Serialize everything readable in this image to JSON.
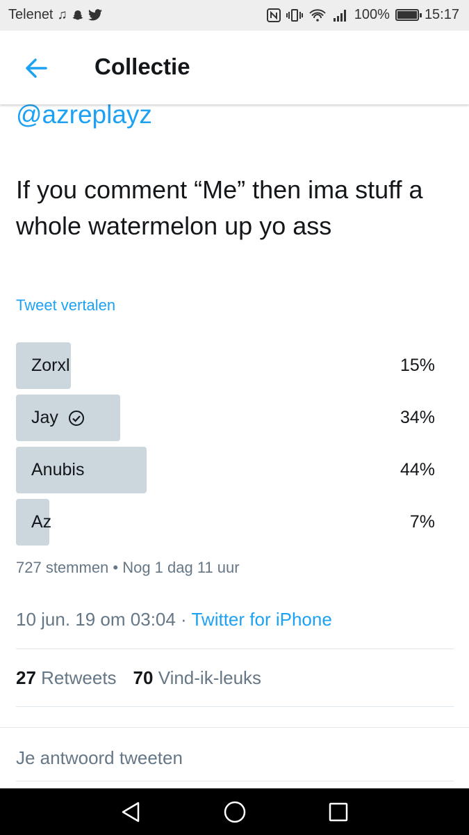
{
  "status_bar": {
    "carrier": "Telenet",
    "battery": "100%",
    "time": "15:17",
    "icons": [
      "music-note-icon",
      "snapchat-icon",
      "twitter-bird-icon",
      "nfc-icon",
      "vibrate-icon",
      "wifi-icon",
      "signal-icon",
      "battery-icon"
    ]
  },
  "header": {
    "title": "Collectie",
    "back_icon": "arrow-left-icon"
  },
  "tweet": {
    "handle": "@azreplayz",
    "text": "If you comment “Me” then ima stuff a whole watermelon up yo ass",
    "translate_label": "Tweet vertalen",
    "poll": {
      "options": [
        {
          "label": "Zorxl",
          "percent_label": "15%",
          "percent": 15,
          "selected": false
        },
        {
          "label": "Jay",
          "percent_label": "34%",
          "percent": 34,
          "selected": true
        },
        {
          "label": "Anubis",
          "percent_label": "44%",
          "percent": 44,
          "selected": false
        },
        {
          "label": "Az",
          "percent_label": "7%",
          "percent": 7,
          "selected": false
        }
      ],
      "meta": "727 stemmen • Nog 1 dag 11 uur"
    },
    "timestamp": "10 jun. 19 om 03:04 · ",
    "source": "Twitter for iPhone",
    "retweets_count": "27",
    "retweets_label": "Retweets",
    "likes_count": "70",
    "likes_label": "Vind-ik-leuks"
  },
  "reply": {
    "placeholder": "Je antwoord tweeten"
  },
  "colors": {
    "accent": "#1da1f2",
    "poll_bar": "#ccd6dd",
    "muted": "#657786"
  }
}
